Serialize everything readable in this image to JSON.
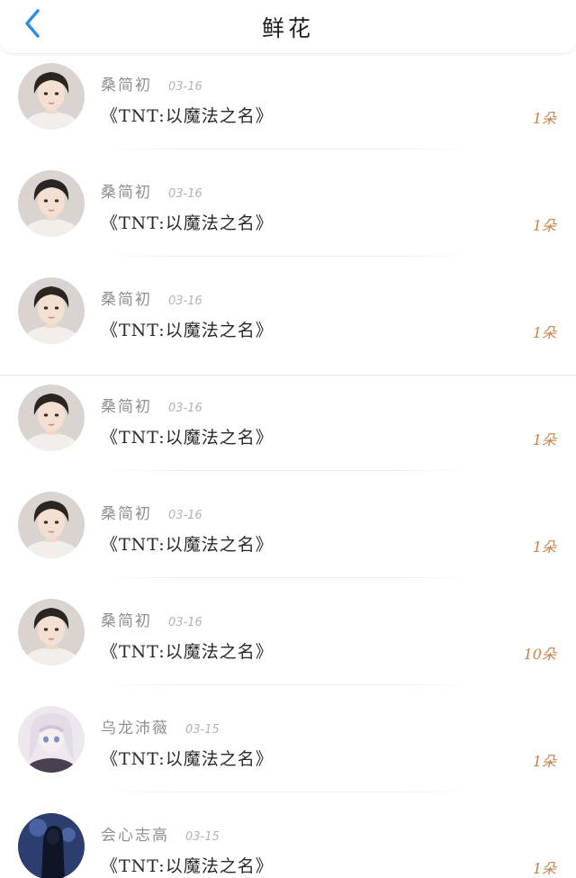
{
  "header": {
    "title": "鲜花",
    "back_icon": "chevron-left-icon",
    "accent": "#2f8fe4"
  },
  "gift_color": "#c8824a",
  "entries": [
    {
      "user": "桑简初",
      "date": "03-16",
      "book": "《TNT:以魔法之名》",
      "count": "1朵",
      "avatar": "girl-short-hair-avatar"
    },
    {
      "user": "桑简初",
      "date": "03-16",
      "book": "《TNT:以魔法之名》",
      "count": "1朵",
      "avatar": "girl-short-hair-avatar"
    },
    {
      "user": "桑简初",
      "date": "03-16",
      "book": "《TNT:以魔法之名》",
      "count": "1朵",
      "avatar": "girl-short-hair-avatar"
    },
    {
      "user": "桑简初",
      "date": "03-16",
      "book": "《TNT:以魔法之名》",
      "count": "1朵",
      "avatar": "girl-short-hair-avatar"
    },
    {
      "user": "桑简初",
      "date": "03-16",
      "book": "《TNT:以魔法之名》",
      "count": "1朵",
      "avatar": "girl-short-hair-avatar"
    },
    {
      "user": "桑简初",
      "date": "03-16",
      "book": "《TNT:以魔法之名》",
      "count": "10朵",
      "avatar": "girl-short-hair-avatar"
    },
    {
      "user": "乌龙沛薇",
      "date": "03-15",
      "book": "《TNT:以魔法之名》",
      "count": "1朵",
      "avatar": "anime-girl-avatar"
    },
    {
      "user": "会心志高",
      "date": "03-15",
      "book": "《TNT:以魔法之名》",
      "count": "1朵",
      "avatar": "long-hair-figure-avatar"
    }
  ]
}
